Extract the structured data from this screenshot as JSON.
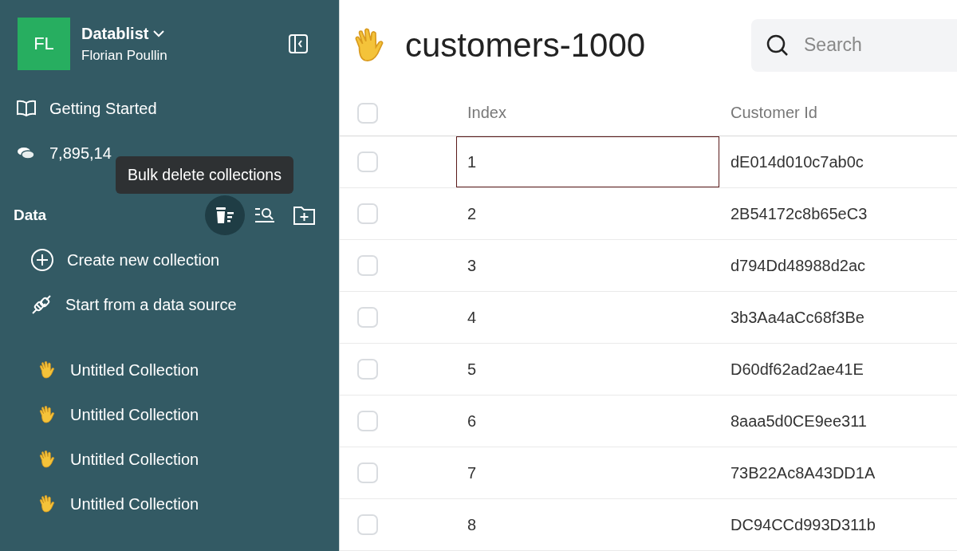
{
  "workspace": {
    "avatar": "FL",
    "name": "Datablist",
    "user": "Florian Poullin"
  },
  "nav": [
    {
      "kind": "book",
      "label": "Getting Started"
    },
    {
      "kind": "coins",
      "label": "7,895,14"
    }
  ],
  "tooltip": "Bulk delete collections",
  "data_section": {
    "title": "Data",
    "tools": [
      {
        "kind": "bulk-delete",
        "selected": true
      },
      {
        "kind": "search-list",
        "selected": false
      },
      {
        "kind": "new-folder",
        "selected": false
      }
    ]
  },
  "actions": [
    {
      "kind": "plus",
      "label": "Create new collection"
    },
    {
      "kind": "plug",
      "label": "Start from a data source"
    }
  ],
  "collections": [
    {
      "label": "Untitled Collection"
    },
    {
      "label": "Untitled Collection"
    },
    {
      "label": "Untitled Collection"
    },
    {
      "label": "Untitled Collection"
    }
  ],
  "title": "customers-1000",
  "search": {
    "placeholder": "Search"
  },
  "table": {
    "header_checked": false,
    "columns": [
      "Index",
      "Customer Id"
    ],
    "rows": [
      {
        "checked": false,
        "focused": true,
        "cells": [
          "1",
          "dE014d010c7ab0c"
        ]
      },
      {
        "checked": false,
        "focused": false,
        "cells": [
          "2",
          "2B54172c8b65eC3"
        ]
      },
      {
        "checked": false,
        "focused": false,
        "cells": [
          "3",
          "d794Dd48988d2ac"
        ]
      },
      {
        "checked": false,
        "focused": false,
        "cells": [
          "4",
          "3b3Aa4aCc68f3Be"
        ]
      },
      {
        "checked": false,
        "focused": false,
        "cells": [
          "5",
          "D60df62ad2ae41E"
        ]
      },
      {
        "checked": false,
        "focused": false,
        "cells": [
          "6",
          "8aaa5d0CE9ee311"
        ]
      },
      {
        "checked": false,
        "focused": false,
        "cells": [
          "7",
          "73B22Ac8A43DD1A"
        ]
      },
      {
        "checked": false,
        "focused": false,
        "cells": [
          "8",
          "DC94CCd993D311b"
        ]
      }
    ]
  }
}
